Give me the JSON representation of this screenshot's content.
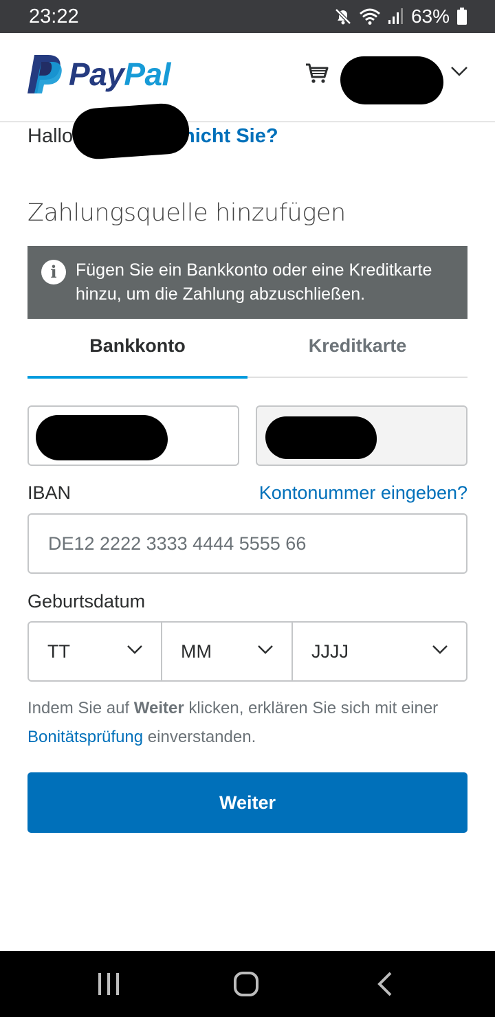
{
  "status_bar": {
    "time": "23:22",
    "battery": "63%",
    "icons": [
      "mute-icon",
      "wifi-icon",
      "signal-icon",
      "battery-icon"
    ]
  },
  "header": {
    "logo_word_1": "Pay",
    "logo_word_2": "Pal",
    "colors": {
      "brand_dark": "#253b80",
      "brand_light": "#179bd7"
    },
    "cart_icon": "cart-icon",
    "account_chevron_icon": "chevron-down-icon"
  },
  "greeting": {
    "hello": "Hallo",
    "not_you_link": "nicht Sie?"
  },
  "section_title": "Zahlungsquelle hinzufügen",
  "notice": {
    "icon": "info-icon",
    "text": "Fügen Sie ein Bankkonto oder eine Kreditkarte hinzu, um die Zahlung abzuschließen."
  },
  "tabs": [
    {
      "label": "Bankkonto",
      "active": true
    },
    {
      "label": "Kreditkarte",
      "active": false
    }
  ],
  "iban": {
    "label": "IBAN",
    "alt_link": "Kontonummer eingeben?",
    "placeholder": "DE12 2222 3333 4444 5555 66"
  },
  "birthdate": {
    "label": "Geburtsdatum",
    "day": "TT",
    "month": "MM",
    "year": "JJJJ"
  },
  "consent": {
    "part1": "Indem Sie auf ",
    "bold": "Weiter",
    "part2": " klicken, erklären Sie sich mit einer ",
    "link": "Bonitätsprüfung",
    "part3": " einverstanden."
  },
  "primary_button": "Weiter",
  "colors": {
    "accent": "#0070ba",
    "tab_underline": "#009cde",
    "notice_bg": "#626768"
  }
}
